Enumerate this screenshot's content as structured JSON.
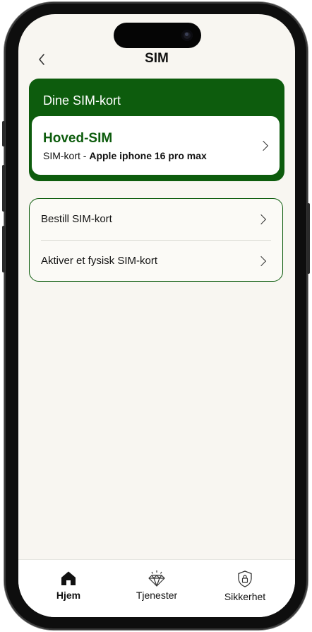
{
  "header": {
    "title": "SIM",
    "back_icon": "chevron-left-icon"
  },
  "sim_section": {
    "title": "Dine SIM-kort",
    "card": {
      "name": "Hoved-SIM",
      "subtitle_prefix": "SIM-kort - ",
      "subtitle_device": "Apple iphone 16 pro max"
    }
  },
  "options": [
    {
      "label": "Bestill SIM-kort"
    },
    {
      "label": "Aktiver et fysisk SIM-kort"
    }
  ],
  "tabbar": {
    "items": [
      {
        "label": "Hjem",
        "icon": "home-icon",
        "active": true
      },
      {
        "label": "Tjenester",
        "icon": "diamond-icon",
        "active": false
      },
      {
        "label": "Sikkerhet",
        "icon": "shield-lock-icon",
        "active": false
      }
    ]
  },
  "colors": {
    "brand_green": "#0d5c0d",
    "background": "#f8f6f1"
  }
}
